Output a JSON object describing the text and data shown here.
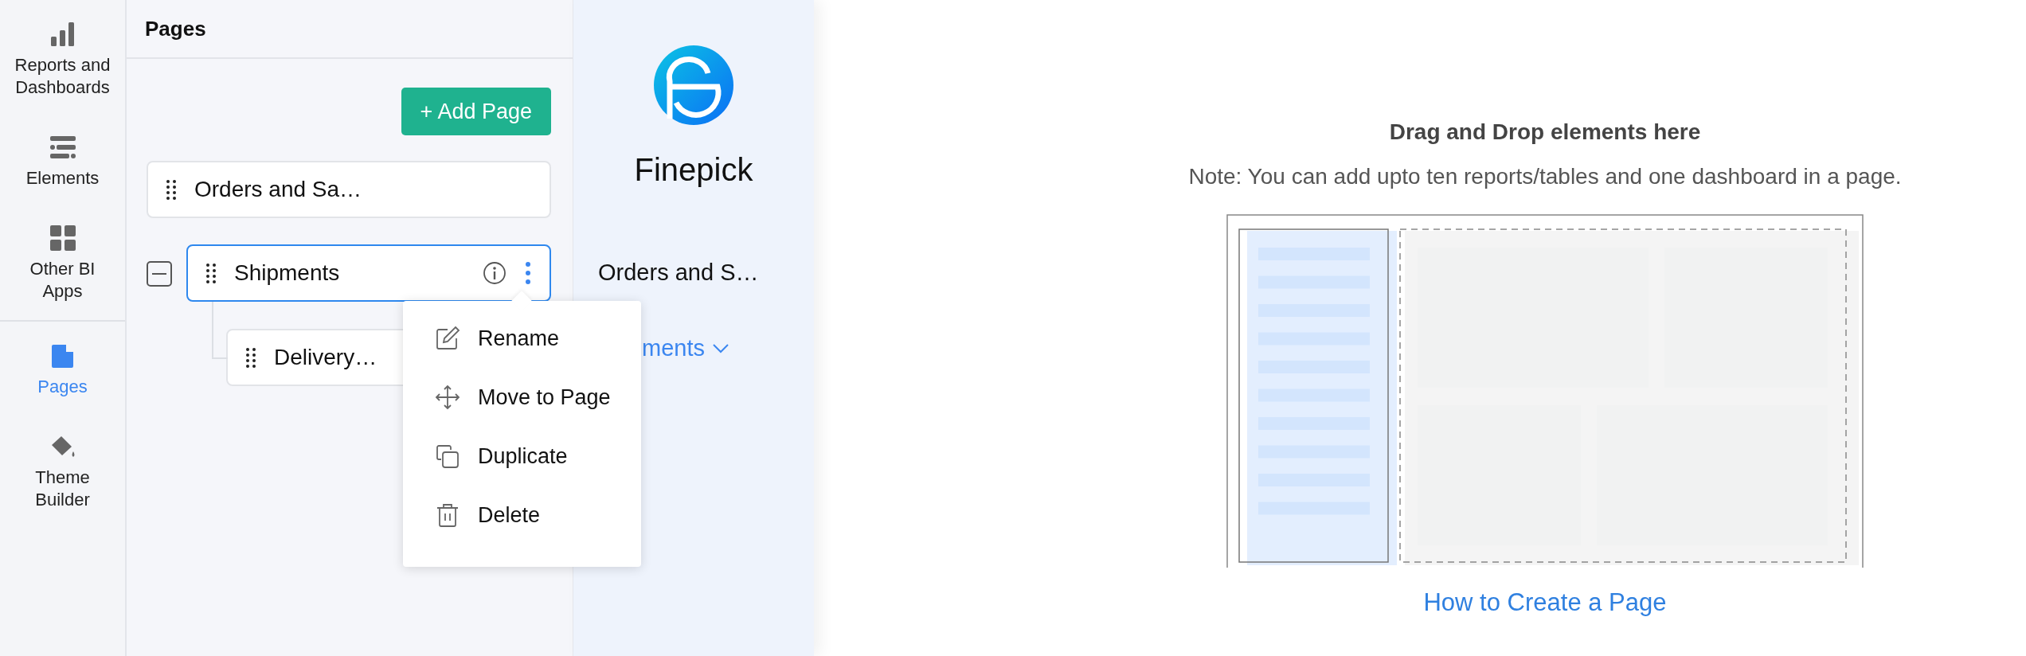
{
  "rail": {
    "groups": [
      [
        {
          "label": "Reports and Dashboards",
          "selected": false
        },
        {
          "label": "Elements",
          "selected": false
        },
        {
          "label": "Other BI Apps",
          "selected": false
        }
      ],
      [
        {
          "label": "Pages",
          "selected": true
        },
        {
          "label": "Theme Builder",
          "selected": false
        }
      ]
    ]
  },
  "pages_panel": {
    "title": "Pages",
    "add_button": "+ Add Page",
    "items": [
      {
        "label": "Orders and Sa…",
        "selected": false
      },
      {
        "label": "Shipments",
        "selected": true,
        "expanded": true,
        "children": [
          {
            "label": "Delivery…",
            "selected": false
          }
        ]
      }
    ]
  },
  "context_menu": {
    "items": [
      {
        "label": "Rename"
      },
      {
        "label": "Move to Page"
      },
      {
        "label": "Duplicate"
      },
      {
        "label": "Delete"
      }
    ]
  },
  "preview": {
    "brand": "Finepick",
    "page_name": "Orders and S…",
    "sub_page": "ments"
  },
  "canvas": {
    "title": "Drag and Drop elements here",
    "note": "Note: You can add upto ten reports/tables and one dashboard in a page.",
    "help_link": "How to Create a Page"
  }
}
